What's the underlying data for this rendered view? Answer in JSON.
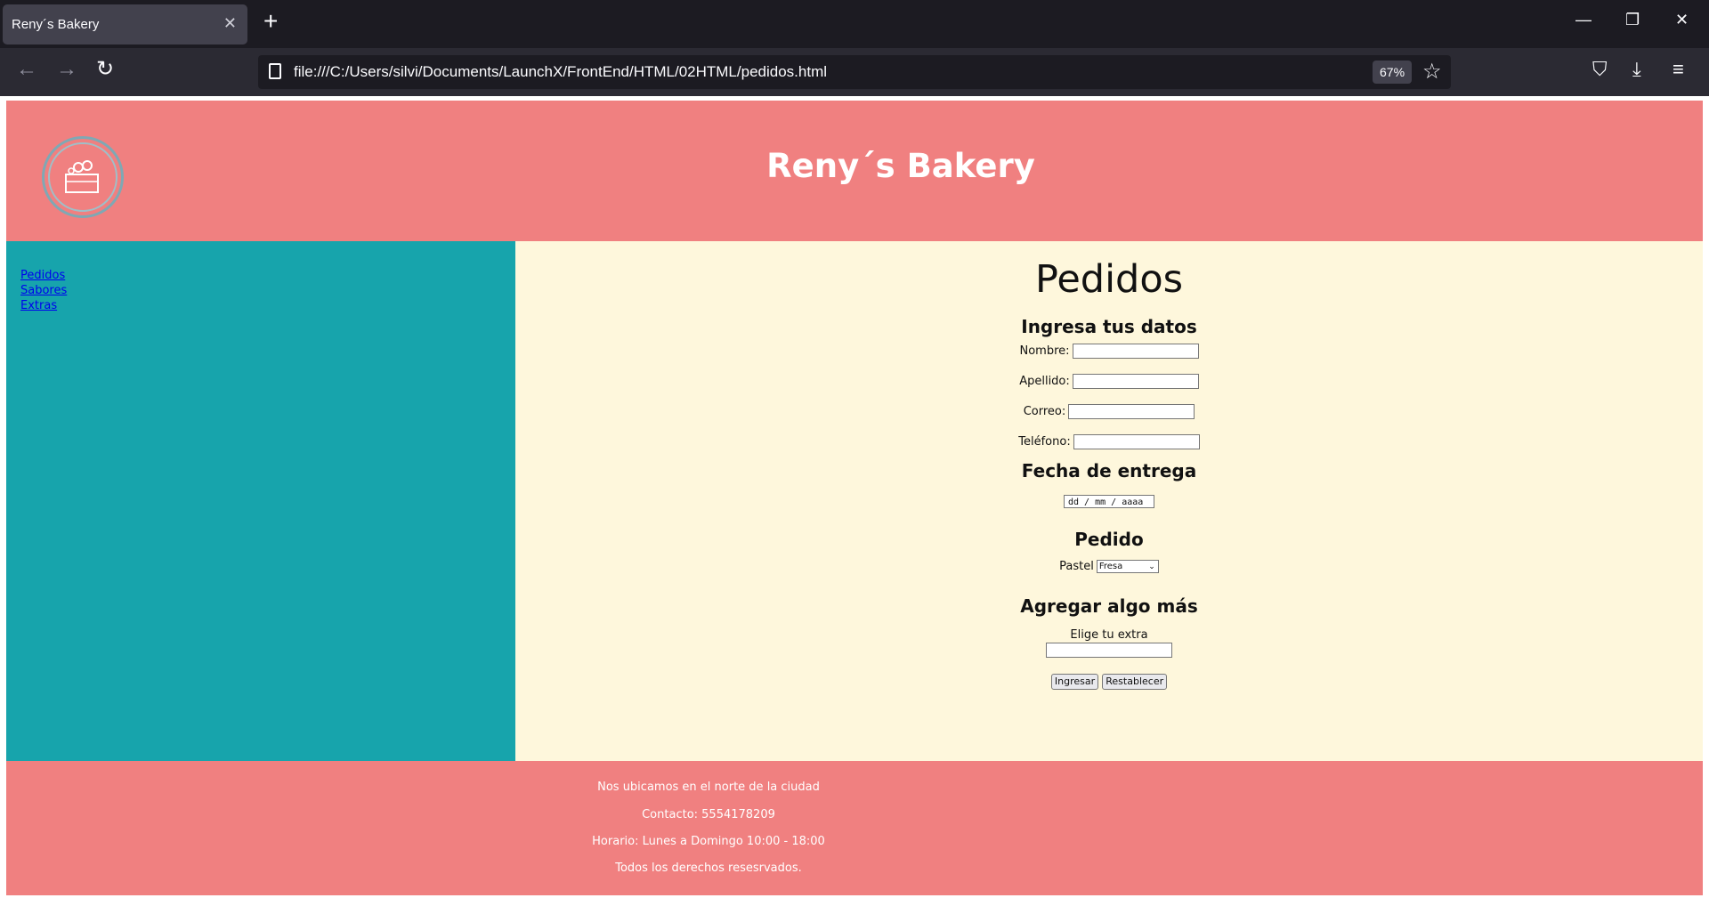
{
  "browser": {
    "tab_title": "Reny´s Bakery",
    "tab_close": "✕",
    "new_tab": "+",
    "url": "file:///C:/Users/silvi/Documents/LaunchX/FrontEnd/HTML/02HTML/pedidos.html",
    "zoom": "67%",
    "back_icon": "←",
    "forward_icon": "→",
    "reload_icon": "↻",
    "star_icon": "☆",
    "pocket_icon": "⛉",
    "download_icon": "⤓",
    "menu_icon": "≡",
    "minimize_icon": "—",
    "restore_icon": "❐",
    "close_icon": "✕"
  },
  "header": {
    "title": "Reny´s Bakery"
  },
  "nav": {
    "links": [
      "Pedidos",
      "Sabores",
      "Extras"
    ]
  },
  "main": {
    "heading": "Pedidos",
    "datos_heading": "Ingresa tus datos",
    "nombre_label": "Nombre:",
    "apellido_label": "Apellido:",
    "correo_label": "Correo:",
    "telefono_label": "Teléfono:",
    "fecha_heading": "Fecha de entrega",
    "fecha_placeholder": "dd / mm / aaaa",
    "pedido_heading": "Pedido",
    "pastel_label": "Pastel",
    "pastel_selected": "Fresa",
    "extra_heading": "Agregar algo más",
    "extra_label": "Elige tu extra",
    "submit_label": "Ingresar",
    "reset_label": "Restablecer"
  },
  "footer": {
    "lines": [
      "Nos ubicamos en el norte de la ciudad",
      "Contacto: 5554178209",
      "Horario: Lunes a Domingo 10:00 - 18:00",
      "Todos los derechos resesrvados."
    ]
  },
  "colors": {
    "header_bg": "#f08080",
    "sidebar_bg": "#17a4ac",
    "content_bg": "#fef7dc"
  }
}
